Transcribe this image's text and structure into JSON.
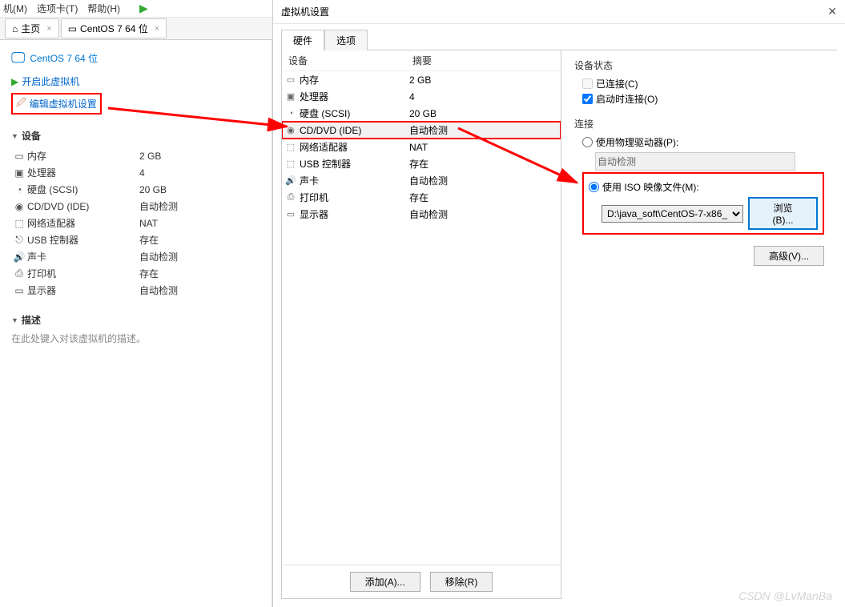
{
  "menu": {
    "m1": "机(M)",
    "m2": "选项卡(T)",
    "m3": "帮助(H)"
  },
  "tabs": {
    "home": "主页",
    "vm": "CentOS 7 64 位"
  },
  "vm": {
    "title": "CentOS 7 64 位",
    "power_on": "开启此虚拟机",
    "edit": "编辑虚拟机设置",
    "devices_header": "设备",
    "desc_header": "描述",
    "desc_hint": "在此处键入对该虚拟机的描述。",
    "rows": [
      {
        "icon": "▭",
        "label": "内存",
        "value": "2 GB"
      },
      {
        "icon": "▣",
        "label": "处理器",
        "value": "4"
      },
      {
        "icon": "◔",
        "label": "硬盘 (SCSI)",
        "value": "20 GB"
      },
      {
        "icon": "◉",
        "label": "CD/DVD (IDE)",
        "value": "自动检测"
      },
      {
        "icon": "�INIC",
        "label": "网络适配器",
        "value": "NAT"
      },
      {
        "icon": "⬚",
        "label": "USB 控制器",
        "value": "存在"
      },
      {
        "icon": "🔊",
        "label": "声卡",
        "value": "自动检测"
      },
      {
        "icon": "⎙",
        "label": "打印机",
        "value": "存在"
      },
      {
        "icon": "▭",
        "label": "显示器",
        "value": "自动检测"
      }
    ]
  },
  "dialog": {
    "title": "虚拟机设置",
    "tabs": {
      "hw": "硬件",
      "opt": "选项"
    },
    "headers": {
      "device": "设备",
      "summary": "摘要"
    },
    "rows": [
      {
        "icon": "▭",
        "label": "内存",
        "value": "2 GB"
      },
      {
        "icon": "▣",
        "label": "处理器",
        "value": "4"
      },
      {
        "icon": "◔",
        "label": "硬盘 (SCSI)",
        "value": "20 GB"
      },
      {
        "icon": "◉",
        "label": "CD/DVD (IDE)",
        "value": "自动检测",
        "selected": true
      },
      {
        "icon": "⬚",
        "label": "网络适配器",
        "value": "NAT"
      },
      {
        "icon": "⬚",
        "label": "USB 控制器",
        "value": "存在"
      },
      {
        "icon": "🔊",
        "label": "声卡",
        "value": "自动检测"
      },
      {
        "icon": "⎙",
        "label": "打印机",
        "value": "存在"
      },
      {
        "icon": "▭",
        "label": "显示器",
        "value": "自动检测"
      }
    ],
    "add": "添加(A)...",
    "remove": "移除(R)",
    "state_title": "设备状态",
    "connected": "已连接(C)",
    "connect_on": "启动时连接(O)",
    "conn_title": "连接",
    "use_phys": "使用物理驱动器(P):",
    "auto_detect": "自动检测",
    "use_iso": "使用 ISO 映像文件(M):",
    "iso_path": "D:\\java_soft\\CentOS-7-x86_",
    "browse": "浏览(B)...",
    "advanced": "高级(V)..."
  },
  "watermark": "CSDN @LvManBa"
}
